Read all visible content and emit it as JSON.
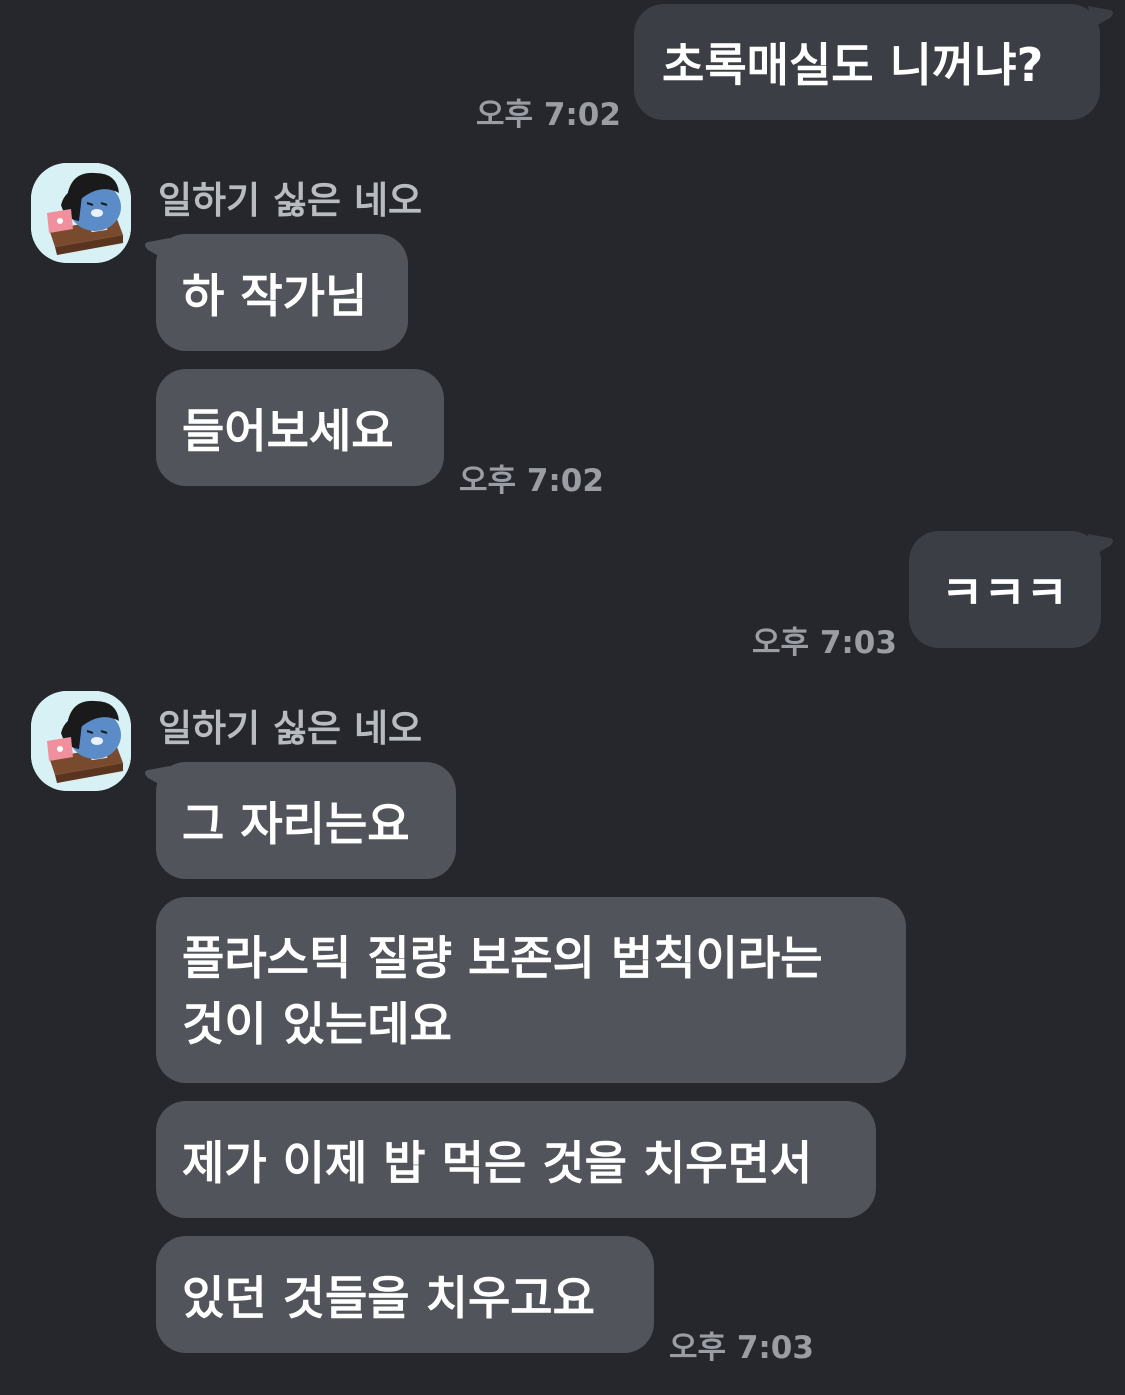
{
  "colors": {
    "background": "#25272c",
    "my_bubble": "#3b3e44",
    "their_bubble": "#51545a",
    "timestamp": "#9a9da3",
    "sender_name": "#b8bbc0",
    "avatar_bg": "#d8f1f4"
  },
  "messages": {
    "m1": {
      "text": "초록매실도 니꺼냐?",
      "time": "오후 7:02"
    },
    "g1": {
      "sender": "일하기 싫은 네오",
      "avatar_icon": "neo-character-avatar-icon",
      "b1": "하 작가님",
      "b2": "들어보세요",
      "time": "오후 7:02"
    },
    "m2": {
      "text": "ㅋㅋㅋ",
      "time": "오후 7:03"
    },
    "g2": {
      "sender": "일하기 싫은 네오",
      "avatar_icon": "neo-character-avatar-icon",
      "b1": "그 자리는요",
      "b2": "플라스틱 질량 보존의 법칙이라는 것이 있는데요",
      "b3": "제가 이제 밥 먹은 것을 치우면서",
      "b4": "있던 것들을 치우고요",
      "time": "오후 7:03"
    }
  }
}
